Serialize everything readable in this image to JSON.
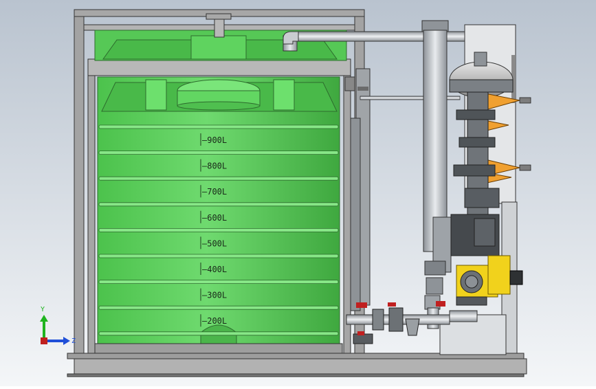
{
  "scene": {
    "background_top": "#b9c3cf",
    "background_bottom": "#f4f6f8",
    "tank_green": "#5ed05e",
    "tank_green_dark": "#3aa23a",
    "frame_gray": "#9a9a9a",
    "pipe_gray": "#c7cbd0",
    "pump_yellow": "#f1d21c",
    "filter_orange": "#f0a030"
  },
  "tank": {
    "volume_marks": [
      "900L",
      "800L",
      "700L",
      "600L",
      "500L",
      "400L",
      "300L",
      "200L"
    ]
  },
  "triad": {
    "y_label": "Y",
    "z_label": "Z",
    "y_color": "#1fb41f",
    "z_color": "#1f4fd8"
  }
}
